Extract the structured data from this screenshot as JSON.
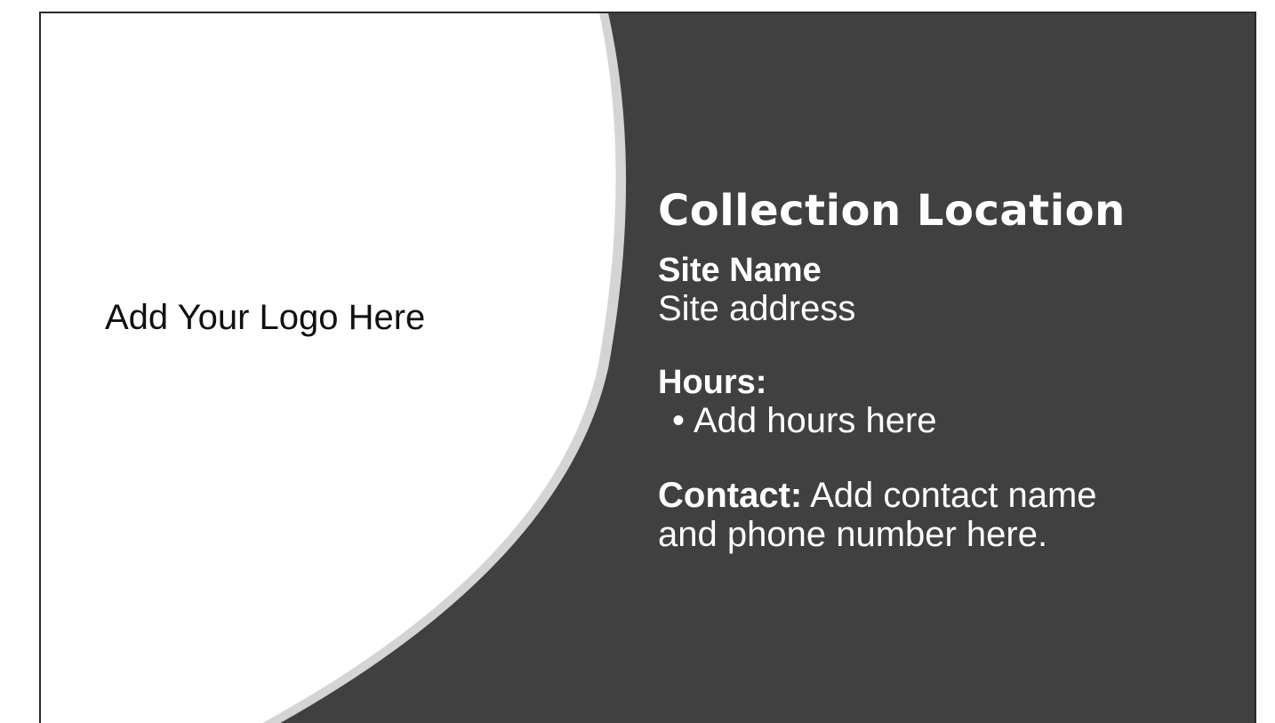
{
  "slide": {
    "logo_placeholder": "Add Your Logo Here",
    "title": "Collection Location",
    "site": {
      "name": "Site Name",
      "address": "Site address"
    },
    "hours": {
      "heading": "Hours:",
      "bullet": "•",
      "items": [
        "Add hours here"
      ]
    },
    "contact": {
      "label": "Contact:",
      "text_line1": " Add contact name",
      "text_line2": "and phone number here."
    }
  },
  "colors": {
    "dark_panel": "#404040",
    "accent_curve": "#d4d4d4",
    "left_panel": "#ffffff",
    "text_light": "#ffffff",
    "text_dark": "#111111"
  }
}
